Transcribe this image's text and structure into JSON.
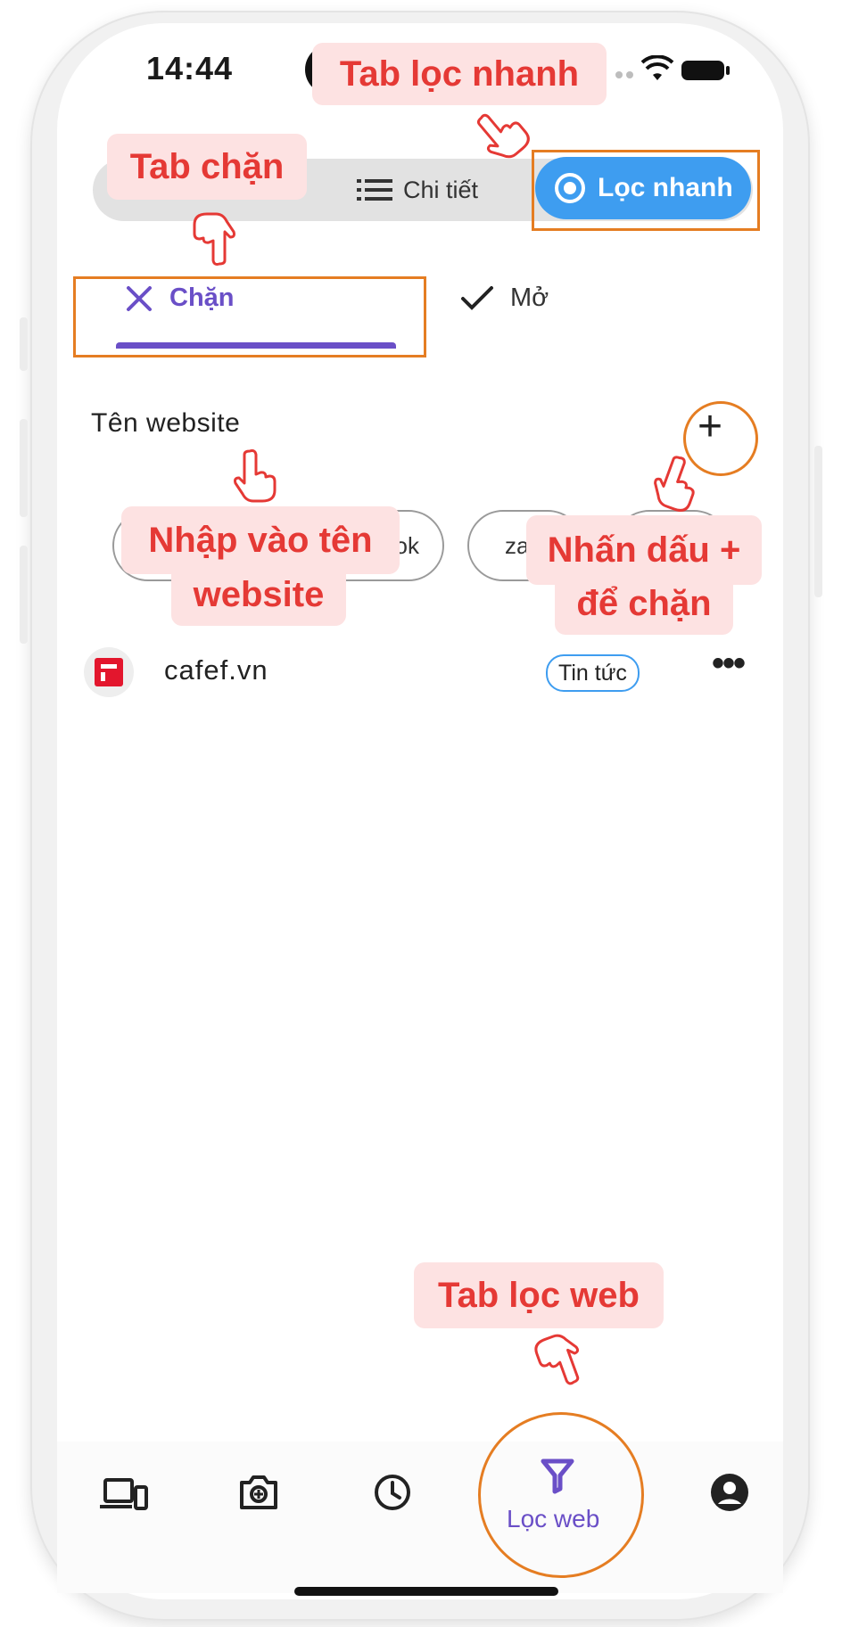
{
  "status_bar": {
    "time": "14:44"
  },
  "segmented": {
    "detail_label": "Chi tiết",
    "quick_label": "Lọc nhanh"
  },
  "tabs": {
    "block_label": "Chặn",
    "open_label": "Mở"
  },
  "website_section": {
    "label": "Tên website"
  },
  "suggestion_chips": [
    {
      "text": "ok"
    },
    {
      "text": "za"
    },
    {
      "text": ""
    }
  ],
  "blocked_list": [
    {
      "name": "cafef.vn",
      "category": "Tin tức"
    }
  ],
  "bottom_nav": {
    "active_label": "Lọc web"
  },
  "annotations": {
    "quick_tab": "Tab lọc nhanh",
    "block_tab": "Tab chặn",
    "enter_name_line1": "Nhập vào tên",
    "enter_name_line2": "website",
    "press_plus_line1": "Nhấn dấu +",
    "press_plus_line2": "để chặn",
    "web_filter_tab": "Tab lọc web"
  },
  "colors": {
    "accent_purple": "#6a4fc7",
    "accent_blue": "#3e9df0",
    "annotation_red": "#e53935",
    "annotation_bg": "#fde2e2",
    "highlight_orange": "#e57d22",
    "favicon_red": "#e3162d"
  },
  "icons": {
    "detail": "list-icon",
    "quick": "radio-target-icon",
    "block": "close-icon",
    "open": "check-icon",
    "add": "plus-icon",
    "more": "more-horizontal-icon",
    "nav": [
      "devices-icon",
      "camera-icon",
      "clock-icon",
      "filter-icon",
      "account-icon"
    ]
  }
}
